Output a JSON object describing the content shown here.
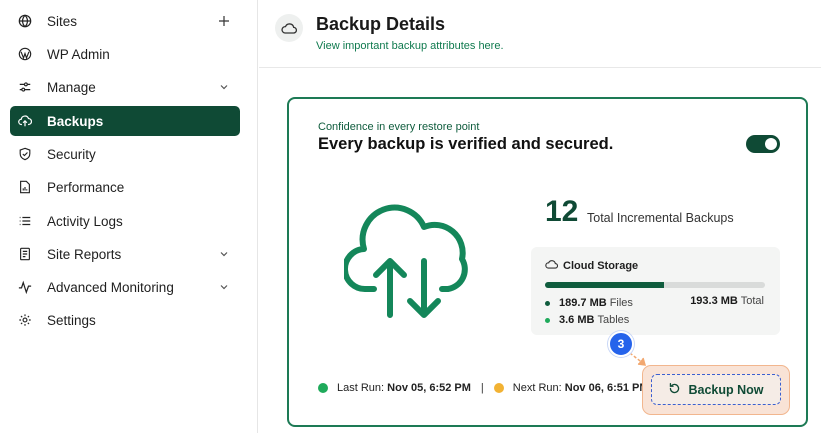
{
  "sidebar": {
    "items": [
      {
        "label": "Sites",
        "icon": "globe-icon",
        "trailing": "plus-icon"
      },
      {
        "label": "WP Admin",
        "icon": "wordpress-icon"
      },
      {
        "label": "Manage",
        "icon": "sliders-icon",
        "trailing": "chevron-down-icon"
      },
      {
        "label": "Backups",
        "icon": "cloud-upload-icon",
        "active": true
      },
      {
        "label": "Security",
        "icon": "shield-icon"
      },
      {
        "label": "Performance",
        "icon": "document-chart-icon"
      },
      {
        "label": "Activity Logs",
        "icon": "list-icon"
      },
      {
        "label": "Site Reports",
        "icon": "report-icon",
        "trailing": "chevron-down-icon"
      },
      {
        "label": "Advanced Monitoring",
        "icon": "pulse-icon",
        "trailing": "chevron-down-icon"
      },
      {
        "label": "Settings",
        "icon": "gear-icon"
      }
    ],
    "active_color": "#0f4a35"
  },
  "header": {
    "title": "Backup Details",
    "subtitle": "View important backup attributes here.",
    "icon": "cloud-icon"
  },
  "card": {
    "tagline": "Confidence in every restore point",
    "headline": "Every backup is verified and secured.",
    "toggle_on": true,
    "border_color": "#1d7a55",
    "incremental_count": "12",
    "incremental_label": "Total Incremental Backups",
    "storage": {
      "title": "Cloud Storage",
      "usage_fraction": 0.54,
      "files_value": "189.7 MB",
      "files_label": "Files",
      "tables_value": "3.6 MB",
      "tables_label": "Tables",
      "total_value": "193.3 MB",
      "total_label": "Total"
    },
    "last_run_label": "Last Run:",
    "last_run_value": "Nov 05, 6:52 PM",
    "next_run_label": "Next Run:",
    "next_run_value": "Nov 06, 6:51 PM",
    "backup_button_label": "Backup Now",
    "step_badge": "3",
    "colors": {
      "last_run": "#1faa5b",
      "next_run": "#f2b233",
      "files_dot": "#0f5c3d",
      "tables_dot": "#1faa5b"
    }
  }
}
